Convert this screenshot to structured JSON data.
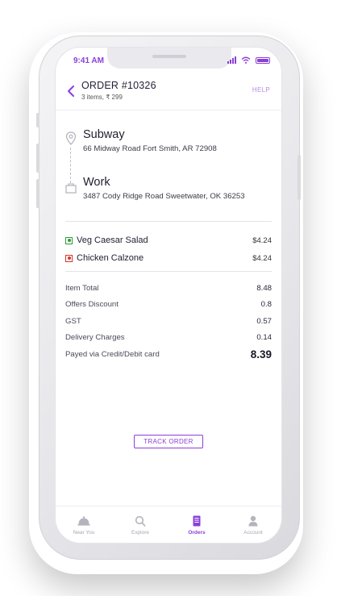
{
  "status_bar": {
    "time": "9:41 AM"
  },
  "header": {
    "title": "ORDER #10326",
    "subtitle": "3 items, ₹ 299",
    "help_label": "HELP"
  },
  "route": {
    "pickup": {
      "name": "Subway",
      "address": "66 Midway Road Fort Smith, AR 72908"
    },
    "dropoff": {
      "name": "Work",
      "address": "3487 Cody Ridge Road Sweetwater, OK 36253"
    }
  },
  "items": [
    {
      "name": "Veg Caesar Salad",
      "price": "$4.24",
      "type": "veg"
    },
    {
      "name": "Chicken Calzone",
      "price": "$4.24",
      "type": "non-veg"
    }
  ],
  "bill": [
    {
      "label": "Item Total",
      "value": "8.48"
    },
    {
      "label": "Offers Discount",
      "value": "0.8"
    },
    {
      "label": "GST",
      "value": "0.57"
    },
    {
      "label": "Delivery Charges",
      "value": "0.14"
    },
    {
      "label": "Payed via Credit/Debit card",
      "value": "8.39"
    }
  ],
  "track_button": "TRACK ORDER",
  "tabs": [
    {
      "label": "Near You",
      "icon": "cloche-icon"
    },
    {
      "label": "Explore",
      "icon": "search-icon"
    },
    {
      "label": "Orders",
      "icon": "orders-icon"
    },
    {
      "label": "Account",
      "icon": "account-icon"
    }
  ],
  "colors": {
    "accent": "#8b3fd9",
    "veg": "#2e9b3a",
    "non_veg": "#d9342b"
  }
}
